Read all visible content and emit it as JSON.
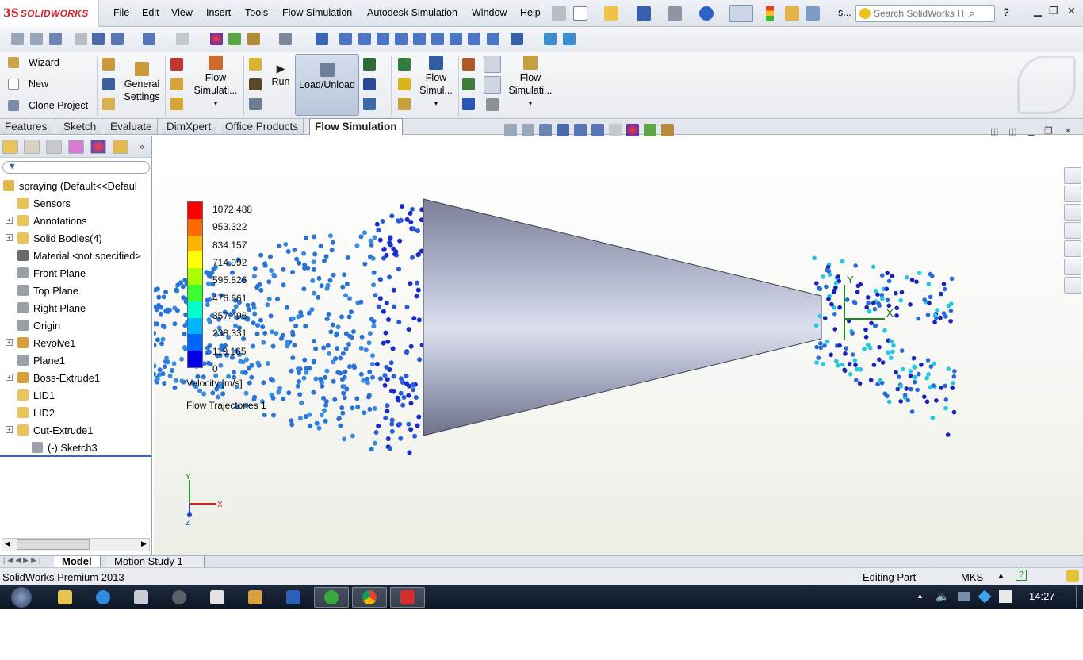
{
  "app": {
    "logo_text": "SOLIDWORKS",
    "logo_mark": "3S"
  },
  "menu": [
    "File",
    "Edit",
    "View",
    "Insert",
    "Tools",
    "Flow Simulation",
    "Autodesk Simulation",
    "Window",
    "Help"
  ],
  "toolbar": {
    "s_dropdown": "s...",
    "help_label": "?"
  },
  "search": {
    "placeholder": "Search SolidWorks H"
  },
  "command_manager": {
    "wizard": "Wizard",
    "new": "New",
    "clone_project": "Clone Project",
    "general_settings_1": "General",
    "general_settings_2": "Settings",
    "flow_sim_1": "Flow",
    "flow_sim_1b": "Simulati...",
    "run": "Run",
    "load_unload": "Load/Unload",
    "flow_sim_2": "Flow",
    "flow_sim_2b": "Simul...",
    "flow_sim_3": "Flow",
    "flow_sim_3b": "Simulati..."
  },
  "tabs": [
    "Features",
    "Sketch",
    "Evaluate",
    "DimXpert",
    "Office Products",
    "Flow Simulation"
  ],
  "active_tab": "Flow Simulation",
  "tree": {
    "root": "spraying  (Default<<Defaul",
    "items": [
      {
        "label": "Sensors",
        "expand": false
      },
      {
        "label": "Annotations",
        "expand": true
      },
      {
        "label": "Solid Bodies(4)",
        "expand": true
      },
      {
        "label": "Material <not specified>",
        "expand": false
      },
      {
        "label": "Front Plane",
        "expand": false
      },
      {
        "label": "Top Plane",
        "expand": false
      },
      {
        "label": "Right Plane",
        "expand": false
      },
      {
        "label": "Origin",
        "expand": false
      },
      {
        "label": "Revolve1",
        "expand": true
      },
      {
        "label": "Plane1",
        "expand": false
      },
      {
        "label": "Boss-Extrude1",
        "expand": true
      },
      {
        "label": "LID1",
        "expand": false
      },
      {
        "label": "LID2",
        "expand": false
      },
      {
        "label": "Cut-Extrude1",
        "expand": true
      },
      {
        "label": "(-) Sketch3",
        "expand": false
      }
    ]
  },
  "legend": {
    "ticks": [
      "1072.488",
      "953.322",
      "834.157",
      "714.992",
      "595.826",
      "476.661",
      "357.496",
      "238.331",
      "119.165",
      "0"
    ],
    "unit_label": "Velocity [m/s]",
    "plot_name": "Flow Trajectories 1",
    "colors": [
      "#ff0000",
      "#ff6a00",
      "#ffb400",
      "#ffff00",
      "#a8ff00",
      "#3cff2e",
      "#00ffcc",
      "#00b4ff",
      "#0064ff",
      "#0000e6"
    ]
  },
  "triad": {
    "x": "X",
    "y": "Y",
    "z": "Z"
  },
  "bottom_tabs": [
    "Model",
    "Motion Study 1"
  ],
  "status": {
    "product": "SolidWorks Premium 2013",
    "mode": "Editing Part",
    "units": "MKS",
    "units_arrow": "▲"
  },
  "taskbar": {
    "clock": "14:27"
  }
}
